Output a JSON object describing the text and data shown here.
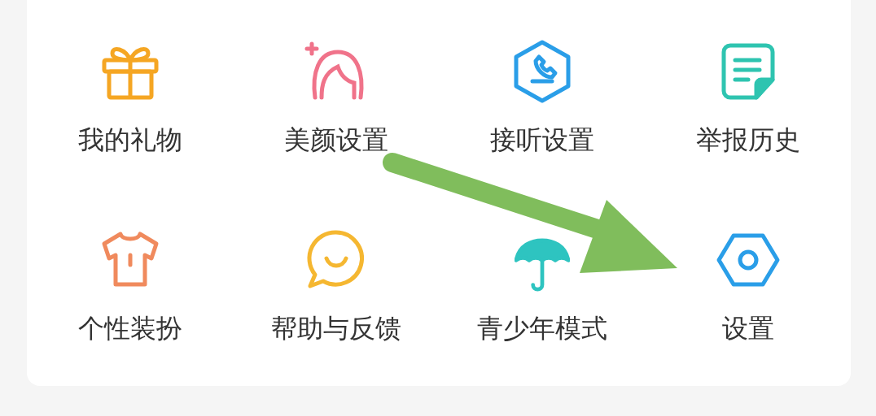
{
  "menu_items": [
    {
      "label": "我的礼物"
    },
    {
      "label": "美颜设置"
    },
    {
      "label": "接听设置"
    },
    {
      "label": "举报历史"
    },
    {
      "label": "个性装扮"
    },
    {
      "label": "帮助与反馈"
    },
    {
      "label": "青少年模式"
    },
    {
      "label": "设置"
    }
  ]
}
